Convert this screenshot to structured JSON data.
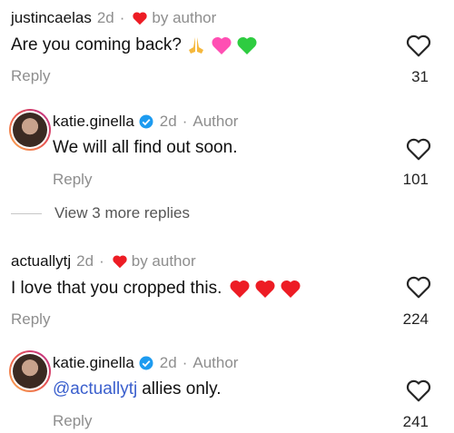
{
  "comments": [
    {
      "username": "justincaelas",
      "time": "2d",
      "badge": "by author",
      "text": "Are you coming back?",
      "reply_label": "Reply",
      "likes": "31"
    },
    {
      "username": "katie.ginella",
      "time": "2d",
      "badge": "Author",
      "text": "We will all find out soon.",
      "reply_label": "Reply",
      "likes": "101"
    },
    {
      "username": "actuallytj",
      "time": "2d",
      "badge": "by author",
      "text": "I love that you cropped this.",
      "reply_label": "Reply",
      "likes": "224"
    },
    {
      "username": "katie.ginella",
      "time": "2d",
      "badge": "Author",
      "mention": "@actuallytj",
      "text": "allies only.",
      "reply_label": "Reply",
      "likes": "241"
    }
  ],
  "view_more_replies": "View 3 more replies",
  "colors": {
    "heart": "#ed1c24",
    "verified": "#1d9bf0",
    "mention": "#3a5fcd"
  }
}
